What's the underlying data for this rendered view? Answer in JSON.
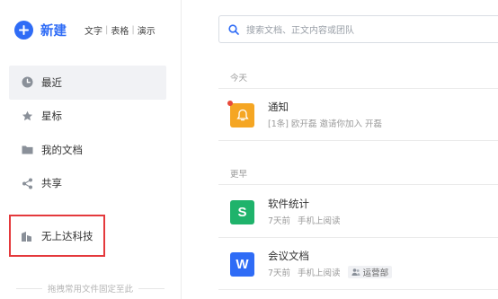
{
  "sidebar": {
    "new_label": "新建",
    "quick_links": [
      "文字",
      "表格",
      "演示"
    ],
    "nav_items": [
      {
        "label": "最近",
        "icon": "clock-icon",
        "active": true
      },
      {
        "label": "星标",
        "icon": "star-icon",
        "active": false
      },
      {
        "label": "我的文档",
        "icon": "folder-icon",
        "active": false
      },
      {
        "label": "共享",
        "icon": "share-icon",
        "active": false
      }
    ],
    "team": {
      "label": "无上达科技",
      "icon": "building-icon",
      "highlight_color": "#e4393c"
    },
    "pin_hint": "拖拽常用文件固定至此"
  },
  "search": {
    "placeholder": "搜索文档、正文内容或团队",
    "icon": "search-icon"
  },
  "sections": {
    "today": "今天",
    "earlier": "更早"
  },
  "docs": [
    {
      "title": "通知",
      "meta": "[1条] 欧开磊 邀请你加入 开磊",
      "icon": "bell-icon",
      "color": "#f5a623",
      "unread": true
    },
    {
      "title": "软件统计",
      "time": "7天前",
      "source": "手机上阅读",
      "icon": "sheet-icon",
      "letter": "S",
      "color": "#1fb36b"
    },
    {
      "title": "会议文档",
      "time": "7天前",
      "source": "手机上阅读",
      "icon": "word-icon",
      "letter": "W",
      "color": "#2f6cf6",
      "tag": "运营部"
    }
  ],
  "colors": {
    "accent": "#2f6cf6"
  }
}
